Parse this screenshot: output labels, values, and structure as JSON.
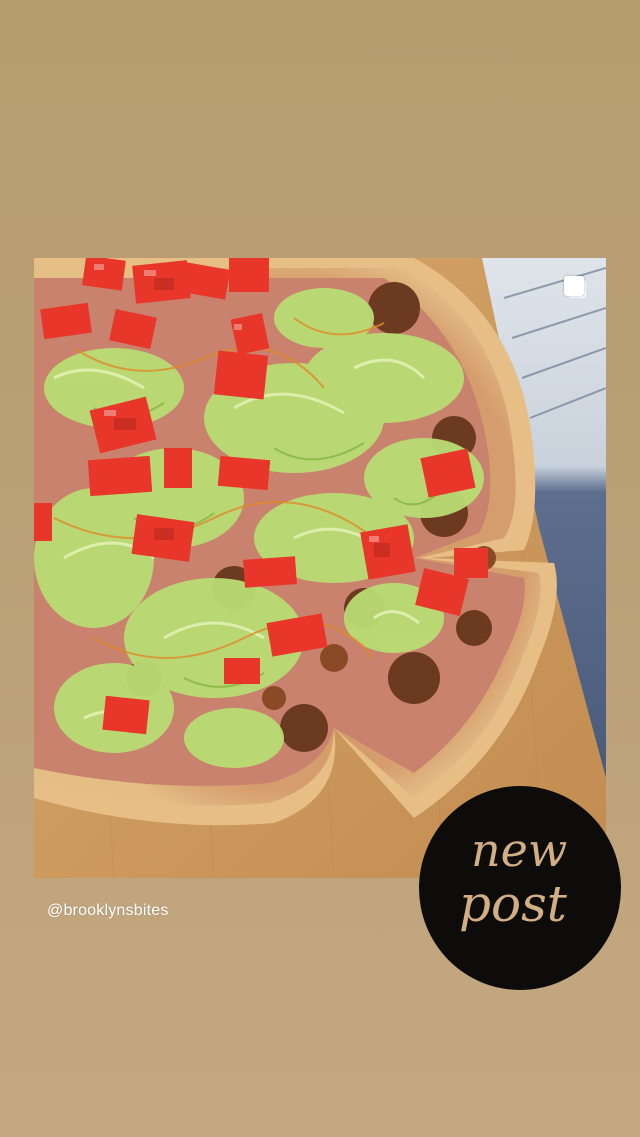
{
  "story": {
    "background_color": "#b9a075",
    "post": {
      "username": "@brooklynsbites",
      "image_description_icon": "multiple-images-icon"
    },
    "sticker": {
      "line1": "new",
      "line2": "post",
      "background_color": "#0d0c0b",
      "text_color": "#d2ae85"
    }
  }
}
